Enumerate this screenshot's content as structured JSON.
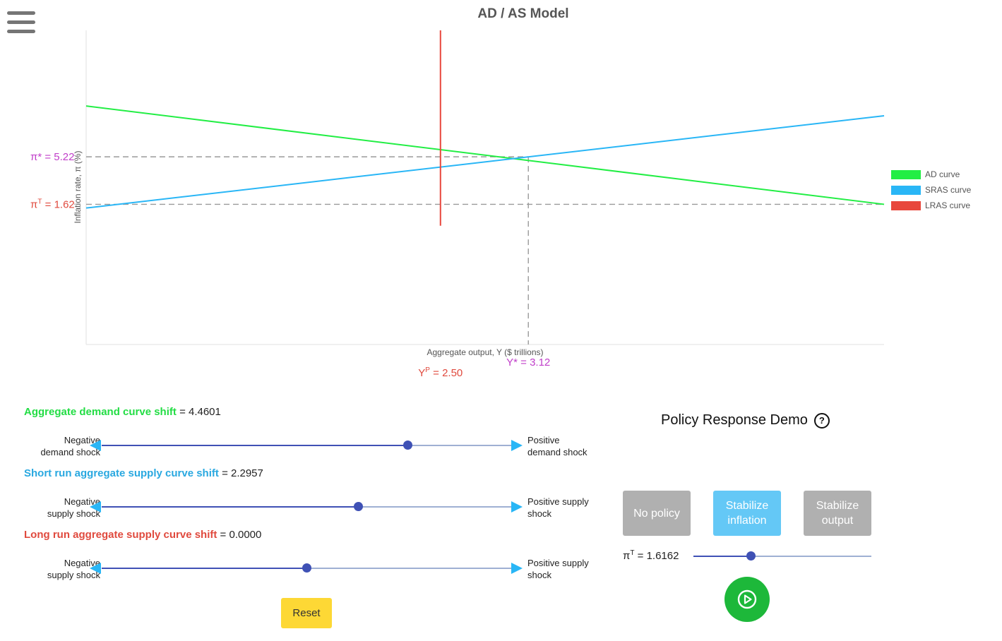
{
  "menu": {
    "icon": "hamburger-menu-icon"
  },
  "chart_data": {
    "type": "line",
    "title": "AD / AS Model",
    "xlabel": "Aggregate output, Y ($ trillions)",
    "ylabel": "Inflation rate, π (%)",
    "series": [
      {
        "name": "AD curve",
        "color": "#22ee44",
        "points": [
          [
            0,
            9.07
          ],
          [
            5.63,
            1.62
          ]
        ]
      },
      {
        "name": "SRAS curve",
        "color": "#29b6f6",
        "points": [
          [
            0,
            1.34
          ],
          [
            5.63,
            8.33
          ]
        ]
      },
      {
        "name": "LRAS curve",
        "color": "#e8473c",
        "points": [
          [
            2.5,
            0
          ],
          [
            2.5,
            14.8
          ]
        ]
      }
    ],
    "xlim": [
      0,
      5.63
    ],
    "ylim": [
      -9.0,
      14.8
    ],
    "reference_lines": [
      {
        "axis": "y",
        "value": 5.22,
        "label": "π* = 5.22",
        "color": "#c03ec9"
      },
      {
        "axis": "y",
        "value": 1.62,
        "label": "πT = 1.62",
        "color": "#e04a3e"
      },
      {
        "axis": "x",
        "value": 3.12,
        "label": "Y* = 3.12",
        "color": "#c03ec9"
      },
      {
        "axis": "x",
        "value": 2.5,
        "label": "YP = 2.50",
        "color": "#e04a3e"
      }
    ],
    "legend_position": "right",
    "grid": false
  },
  "controls": {
    "ad": {
      "label": "Aggregate demand curve shift",
      "value": "= 4.4601",
      "color": "#22dd44",
      "left": "Negative\ndemand shock",
      "right": "Positive\ndemand shock",
      "position": 0.747
    },
    "sras": {
      "label": "Short run aggregate supply curve shift",
      "value": "= 2.2957",
      "color": "#29a8e0",
      "left": "Negative\nsupply shock",
      "right": "Positive supply\nshock",
      "position": 0.626
    },
    "lras": {
      "label": "Long run aggregate supply curve shift",
      "value": "= 0.0000",
      "color": "#e04a3e",
      "left": "Negative\nsupply shock",
      "right": "Positive supply\nshock",
      "position": 0.5
    },
    "reset_label": "Reset"
  },
  "policy": {
    "title": "Policy Response Demo",
    "help_icon": "question-circle-icon",
    "buttons": [
      {
        "label": "No policy",
        "active": false
      },
      {
        "label": "Stabilize inflation",
        "active": true
      },
      {
        "label": "Stabilize output",
        "active": false
      }
    ],
    "target_symbol": "π",
    "target_sup": "T",
    "target_value": "= 1.6162",
    "target_position": 0.32,
    "play_icon": "play-circle-icon"
  }
}
